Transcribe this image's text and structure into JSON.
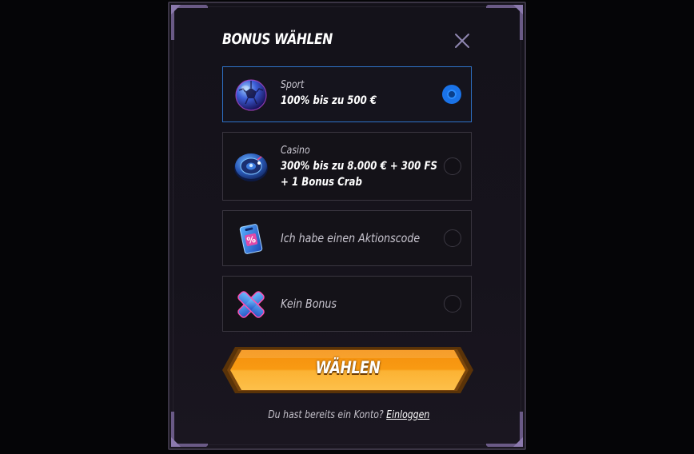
{
  "modal": {
    "title": "BONUS WÄHLEN"
  },
  "options": [
    {
      "label": "Sport",
      "value": "100% bis zu 500 €",
      "value_line2": "",
      "selected": true,
      "icon": "soccer-ball-icon"
    },
    {
      "label": "Casino",
      "value": "300% bis zu 8.000 € + 300 FS",
      "value_line2": "+ 1 Bonus Crab",
      "selected": false,
      "icon": "roulette-wheel-icon"
    },
    {
      "text": "Ich habe einen Aktionscode",
      "selected": false,
      "icon": "promo-tag-icon"
    },
    {
      "text": "Kein Bonus",
      "selected": false,
      "icon": "x-mark-icon"
    }
  ],
  "cta": {
    "label": "WÄHLEN"
  },
  "footer": {
    "question": "Du hast bereits ein Konto?",
    "link": "Einloggen"
  },
  "colors": {
    "accent": "#1a73e8",
    "cta_orange": "#f7a21a",
    "selected_border": "#2f73c9"
  }
}
